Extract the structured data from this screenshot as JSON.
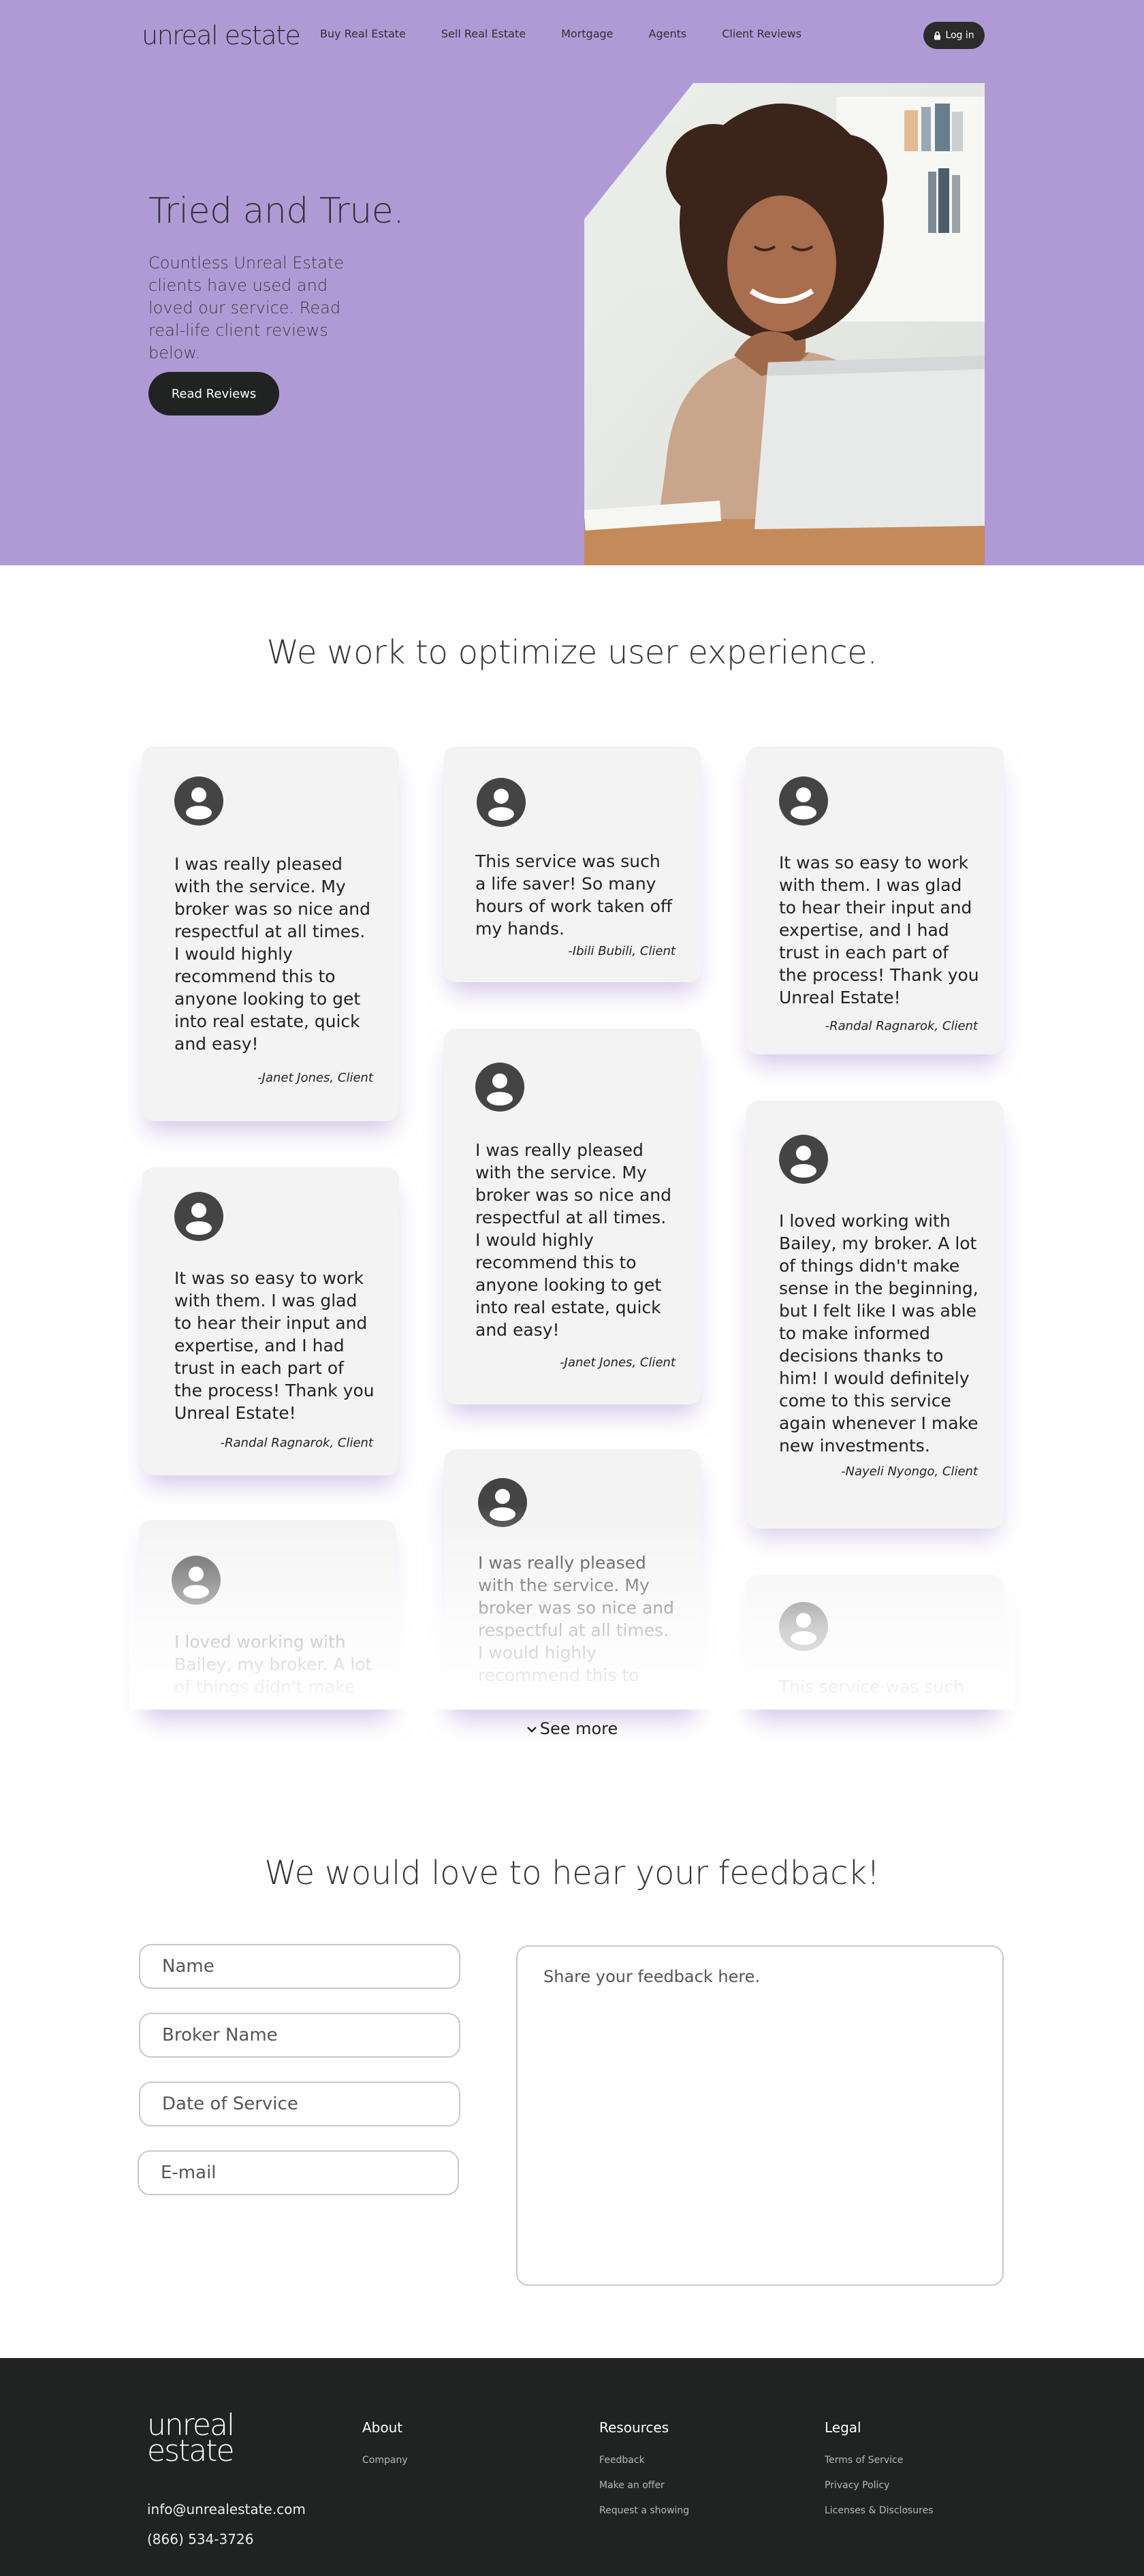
{
  "header": {
    "logo": "unreal estate",
    "nav": [
      "Buy Real Estate",
      "Sell Real Estate",
      "Mortgage",
      "Agents",
      "Client Reviews"
    ],
    "login_label": "Log in"
  },
  "hero": {
    "title": "Tried and True.",
    "subtitle": "Countless Unreal Estate clients have used and loved our service. Read real-life client reviews below.",
    "button_label": "Read Reviews"
  },
  "testimonials": {
    "title": "We work to optimize user experience.",
    "cards": [
      {
        "text": "I was really pleased with the service. My broker was so nice and respectful at all times. I would highly recommend this to anyone looking to get into real estate, quick and easy!",
        "author": "-Janet Jones, Client"
      },
      {
        "text": "This service was such a life saver! So many hours of work taken off my hands.",
        "author": "-Ibili Bubili, Client"
      },
      {
        "text": "It was so easy to work with them. I was glad to hear their input and expertise, and I had trust in each part of the process! Thank you Unreal Estate!",
        "author": "-Randal Ragnarok, Client"
      },
      {
        "text": "I was really pleased with the service. My broker was so nice and respectful at all times. I would highly recommend this to anyone looking to get into real estate, quick and easy!",
        "author": "-Janet Jones, Client"
      },
      {
        "text": "It was so easy to work with them. I was glad to hear their input and expertise, and I had trust in each part of the process! Thank you Unreal Estate!",
        "author": "-Randal Ragnarok, Client"
      },
      {
        "text": "I loved working with Bailey, my broker. A lot of things didn't make sense in the beginning, but I felt like I was able to make informed decisions thanks to him! I would definitely come to this service again whenever I make new investments.",
        "author": "-Nayeli Nyongo, Client"
      },
      {
        "text": "I loved working with Bailey, my broker. A lot of things didn't make sense"
      },
      {
        "text": "I was really pleased with the service. My broker was so nice and respectful at all times. I would highly recommend this to"
      },
      {
        "text": "This service was such a"
      }
    ],
    "see_more": "See more"
  },
  "feedback": {
    "title": "We would love to hear your feedback!",
    "name_placeholder": "Name",
    "broker_placeholder": "Broker Name",
    "date_placeholder": "Date of Service",
    "email_placeholder": "E-mail",
    "message_placeholder": "Share your feedback here."
  },
  "footer": {
    "logo_line1": "unreal",
    "logo_line2": "estate",
    "email": "info@unrealestate.com",
    "phone": "(866) 534-3726",
    "about": {
      "heading": "About",
      "links": [
        "Company"
      ]
    },
    "resources": {
      "heading": "Resources",
      "links": [
        "Feedback",
        "Make an offer",
        "Request a showing"
      ]
    },
    "legal": {
      "heading": "Legal",
      "links": [
        "Terms of Service",
        "Privacy Policy",
        "Licenses & Disclosures"
      ]
    }
  },
  "colors": {
    "hero_bg": "#b09ad6",
    "dark": "#202322",
    "card_bg": "#f3f3f3"
  },
  "icons": [
    "lock-icon",
    "user-avatar-icon",
    "chevron-down-icon"
  ]
}
